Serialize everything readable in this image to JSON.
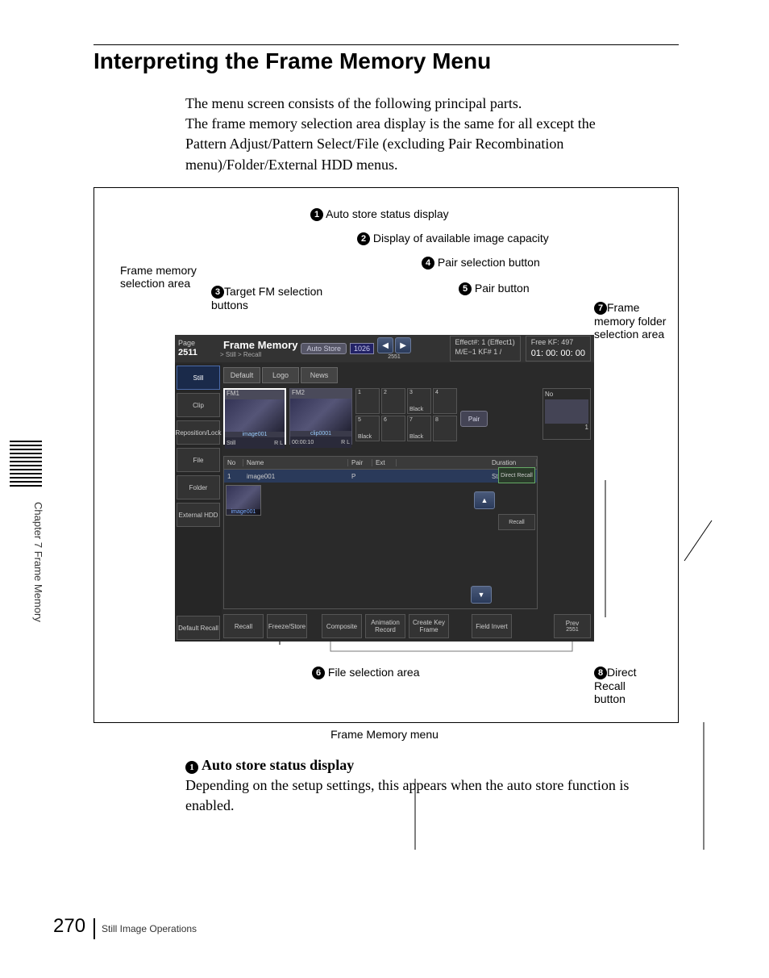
{
  "sidebar_vertical": "Chapter 7  Frame Memory",
  "page_title": "Interpreting the Frame Memory Menu",
  "intro_lines": [
    "The menu screen consists of the following principal parts.",
    "The frame memory selection area display is the same for all except the Pattern Adjust/Pattern Select/File (excluding Pair Recombination menu)/Folder/External HDD menus."
  ],
  "callouts": {
    "c1": "Auto store status display",
    "c2": "Display of available image capacity",
    "c3": "Target FM selection buttons",
    "c4": "Pair selection button",
    "c5": "Pair button",
    "c6": "File selection area",
    "c7": "Frame memory folder selection area",
    "c8": "Direct Recall button",
    "fm_sel": "Frame memory selection area"
  },
  "screen": {
    "page_label": "Page",
    "page_num": "2511",
    "title": "Frame Memory",
    "sub": "> Still > Recall",
    "auto_store": "Auto Store",
    "counter": "1026",
    "counter_below": "2551",
    "effect": "Effect#: 1 (Effect1)",
    "me": "M/E−1   KF# 1 /",
    "free": "Free KF: 497",
    "timecode": "01: 00: 00: 00",
    "left": [
      "Still",
      "Clip",
      "Reposition/Lock",
      "File",
      "Folder",
      "External HDD",
      "Default Recall"
    ],
    "tabs": [
      "Default",
      "Logo",
      "News"
    ],
    "fm1": {
      "label": "FM1",
      "name": "image001",
      "kind": "Still",
      "rl": "R L"
    },
    "fm2": {
      "label": "FM2",
      "name": "clip0001",
      "dur": "00:00:10",
      "rl": "R L"
    },
    "slots": [
      "1",
      "2",
      "3",
      "4",
      "5",
      "6",
      "7",
      "8"
    ],
    "slot_black": "Black",
    "pair_btn": "Pair",
    "right_no": "No",
    "right_num": "1",
    "thead": {
      "no": "No",
      "name": "Name",
      "pair": "Pair",
      "ext": "Ext",
      "dur": "Duration"
    },
    "trow": {
      "no": "1",
      "name": "image001",
      "pair": "P",
      "dur": "Still"
    },
    "thumb": "image001",
    "direct_recall": "Direct Recall",
    "recall": "Recall",
    "bottom": [
      "Recall",
      "Freeze/Store",
      "Composite",
      "Animation Record",
      "Create Key Frame",
      "Field Invert"
    ],
    "prev": "Prev",
    "prev_num": "2551"
  },
  "fig_caption": "Frame Memory menu",
  "section_a": {
    "heading": "Auto store status display",
    "body": "Depending on the setup settings, this appears when the auto store function is enabled."
  },
  "page_number": "270",
  "footer": "Still Image Operations"
}
